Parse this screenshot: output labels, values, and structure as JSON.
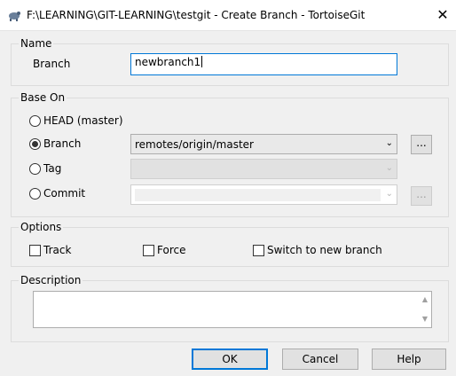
{
  "window": {
    "title": "F:\\LEARNING\\GIT-LEARNING\\testgit - Create Branch - TortoiseGit",
    "close_glyph": "✕"
  },
  "name_group": {
    "label": "Name",
    "branch_label": "Branch",
    "branch_value": "newbranch1"
  },
  "base_on": {
    "label": "Base On",
    "options": [
      {
        "label": "HEAD (master)",
        "selected": false
      },
      {
        "label": "Branch",
        "selected": true
      },
      {
        "label": "Tag",
        "selected": false
      },
      {
        "label": "Commit",
        "selected": false
      }
    ],
    "branch_value": "remotes/origin/master",
    "browse_label": "...",
    "dropdown_glyph": "⌄"
  },
  "options_group": {
    "label": "Options",
    "track": {
      "label": "Track",
      "checked": false
    },
    "force": {
      "label": "Force",
      "checked": false
    },
    "switch": {
      "label": "Switch to new branch",
      "checked": false
    }
  },
  "description": {
    "label": "Description",
    "value": ""
  },
  "buttons": {
    "ok": "OK",
    "cancel": "Cancel",
    "help": "Help"
  }
}
